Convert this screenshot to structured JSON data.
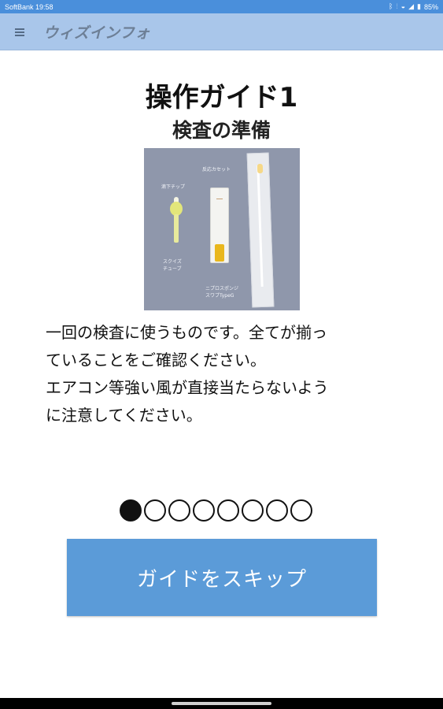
{
  "status_bar": {
    "carrier_time": "SoftBank 19:58",
    "battery": "85%",
    "icons": [
      "bluetooth-icon",
      "vibrate-icon",
      "wifi-icon",
      "signal-icon",
      "battery-icon"
    ]
  },
  "app_bar": {
    "title": "ウィズインフォ"
  },
  "guide": {
    "title": "操作ガイド1",
    "subtitle": "検査の準備",
    "photo_labels": {
      "dropper_tip": "滴下チップ",
      "squeeze_tube": "スクイズ\nチューブ",
      "cassette": "反応カセット",
      "swab": "ニプロスポンジ\nスワブTypeG"
    },
    "description": "一回の検査に使うものです。全てが揃っ\nていることをご確認ください。\nエアコン等強い風が直接当たらないよう\nに注意してください。"
  },
  "pager": {
    "current_page": 1,
    "total_pages": 8
  },
  "skip_button": {
    "label": "ガイドをスキップ"
  },
  "colors": {
    "status_bar": "#4a8fdb",
    "app_bar": "#a9c6ea",
    "button": "#5b9bd8"
  }
}
